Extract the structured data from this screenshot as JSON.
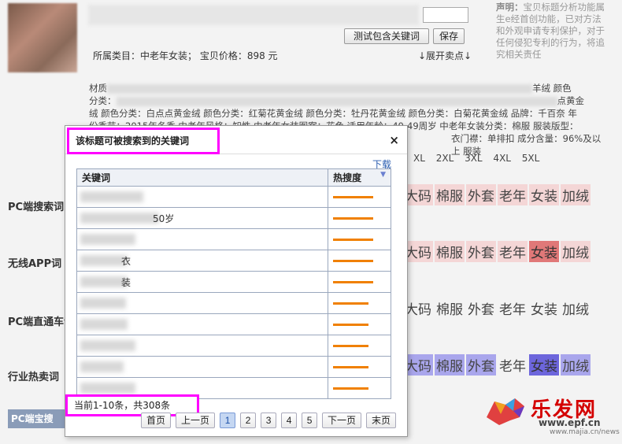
{
  "header": {
    "test_button": "测试包含关键词",
    "save_button": "保存",
    "category_line": "所属类目：中老年女装；   宝贝价格：898 元",
    "expand_link": "↓展开卖点↓",
    "notice_title": "声明：",
    "notice_text": "宝贝标题分析功能属生e经首创功能，已对方法和外观申请专利保护，对于任何侵犯专利的行为，将追究相关责任"
  },
  "attributes": {
    "line1_prefix": "材质",
    "line1_suffix": "羊绒  颜色",
    "line2_prefix": "分类：",
    "line2_suffix": "点黄金",
    "line3": "绒  颜色分类：白点点黄金绒  颜色分类：红菊花黄金绒  颜色分类：牡丹花黄金绒  颜色分类：白菊花黄金绒  品牌：千百奈  年",
    "line4": "份季节：2015年冬季  中老年风格：知性  中老年女装图案：花色  适用年龄：40-49周岁  中老年女装分类：棉服  服装版型：",
    "line5": "衣门襟：单排扣  成分含量：96%及以上  服装",
    "sizes": "XL 2XL 3XL 4XL 5XL"
  },
  "sections": [
    {
      "label": "PC端搜索词",
      "keywords": [
        {
          "t": "大码",
          "c": "pink"
        },
        {
          "t": "棉服",
          "c": "pink"
        },
        {
          "t": "外套",
          "c": "pink"
        },
        {
          "t": "老年",
          "c": "pink"
        },
        {
          "t": "女装",
          "c": "pink"
        },
        {
          "t": "加绒",
          "c": "pink"
        }
      ]
    },
    {
      "label": "无线APP词",
      "keywords": [
        {
          "t": "大码",
          "c": "pink"
        },
        {
          "t": "棉服",
          "c": "pink"
        },
        {
          "t": "外套",
          "c": "pink"
        },
        {
          "t": "老年",
          "c": "pink"
        },
        {
          "t": "女装",
          "c": "red"
        },
        {
          "t": "加绒",
          "c": "pink"
        }
      ]
    },
    {
      "label": "PC端直通车词",
      "keywords": [
        {
          "t": "大码",
          "c": ""
        },
        {
          "t": "棉服",
          "c": ""
        },
        {
          "t": "外套",
          "c": ""
        },
        {
          "t": "老年",
          "c": ""
        },
        {
          "t": "女装",
          "c": ""
        },
        {
          "t": "加绒",
          "c": ""
        }
      ]
    },
    {
      "label": "行业热卖词",
      "keywords": [
        {
          "t": "大码",
          "c": "lav"
        },
        {
          "t": "棉服",
          "c": "lav"
        },
        {
          "t": "外套",
          "c": "lav"
        },
        {
          "t": "老年",
          "c": ""
        },
        {
          "t": "女装",
          "c": "blue"
        },
        {
          "t": "加绒",
          "c": "lav"
        }
      ]
    }
  ],
  "bottom_tab": "PC端宝搜",
  "logo": {
    "text": "乐发网",
    "url": "www.epf.cn",
    "sub": "www.majia.cn/news"
  },
  "modal": {
    "title": "该标题可被搜索到的关键词",
    "close": "×",
    "download": "下载",
    "col_keyword": "关键词",
    "col_heat": "热搜度",
    "rows": [
      {
        "kw": "",
        "heat": 0.85
      },
      {
        "kw": "50岁",
        "heat": 0.85
      },
      {
        "kw": "",
        "heat": 0.85
      },
      {
        "kw": "衣",
        "heat": 0.85
      },
      {
        "kw": "装",
        "heat": 0.85
      },
      {
        "kw": "",
        "heat": 0.75
      },
      {
        "kw": "",
        "heat": 0.75
      },
      {
        "kw": "",
        "heat": 0.75
      },
      {
        "kw": "",
        "heat": 0.75
      },
      {
        "kw": "",
        "heat": 0.75
      }
    ],
    "page_info": "当前1-10条，共308条",
    "pager": {
      "first": "首页",
      "prev": "上一页",
      "pages": [
        "1",
        "2",
        "3",
        "4",
        "5"
      ],
      "next": "下一页",
      "last": "末页"
    }
  },
  "colors": {
    "highlight_border": "#ff00ff",
    "heat_bar": "#f08000"
  }
}
